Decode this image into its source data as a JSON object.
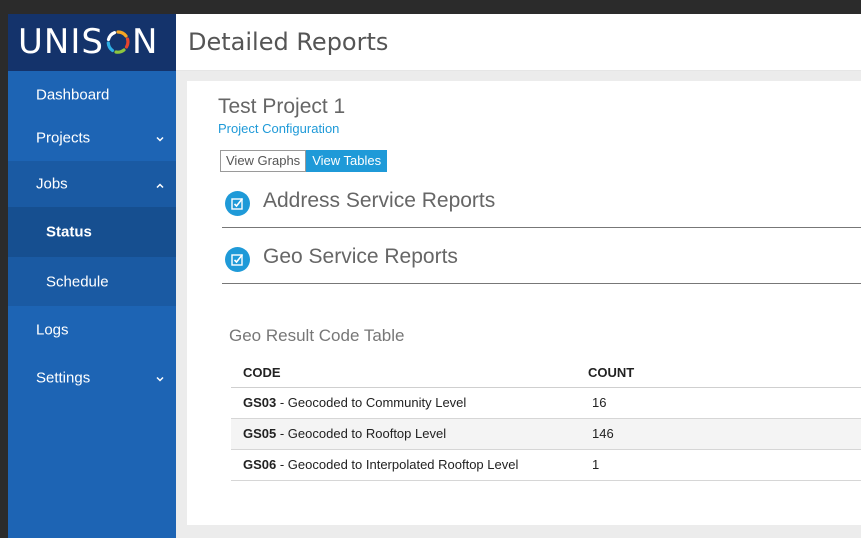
{
  "app": {
    "logo": {
      "pre": "UNIS",
      "post": "N"
    },
    "colors": {
      "sidebar": "#1d64b4",
      "logo_bar": "#14336b",
      "accent": "#1f9ad8"
    }
  },
  "sidebar": {
    "items": [
      {
        "label": "Dashboard",
        "icon": ""
      },
      {
        "label": "Projects",
        "icon": "chevron-down-icon",
        "glyph": "⌄"
      },
      {
        "label": "Jobs",
        "icon": "chevron-up-icon",
        "glyph": "⌃"
      },
      {
        "label": "Status",
        "icon": ""
      },
      {
        "label": "Schedule",
        "icon": ""
      },
      {
        "label": "Logs",
        "icon": ""
      },
      {
        "label": "Settings",
        "icon": "chevron-down-icon",
        "glyph": "⌄"
      }
    ]
  },
  "header": {
    "title": "Detailed Reports"
  },
  "main": {
    "project_title": "Test Project 1",
    "project_config_link": "Project Configuration",
    "view_toggle": {
      "graphs_label": "View Graphs",
      "tables_label": "View Tables",
      "selected": "View Tables"
    },
    "sections": [
      {
        "label": "Address Service Reports",
        "icon": "checklist-icon"
      },
      {
        "label": "Geo Service Reports",
        "icon": "checklist-icon"
      }
    ],
    "geo_table": {
      "title": "Geo Result Code Table",
      "headers": {
        "code": "CODE",
        "count": "COUNT"
      },
      "rows": [
        {
          "code": "GS03",
          "desc": " - Geocoded to Community Level",
          "count": "16"
        },
        {
          "code": "GS05",
          "desc": " - Geocoded to Rooftop Level",
          "count": "146"
        },
        {
          "code": "GS06",
          "desc": " - Geocoded to Interpolated Rooftop Level",
          "count": "1"
        }
      ]
    }
  }
}
